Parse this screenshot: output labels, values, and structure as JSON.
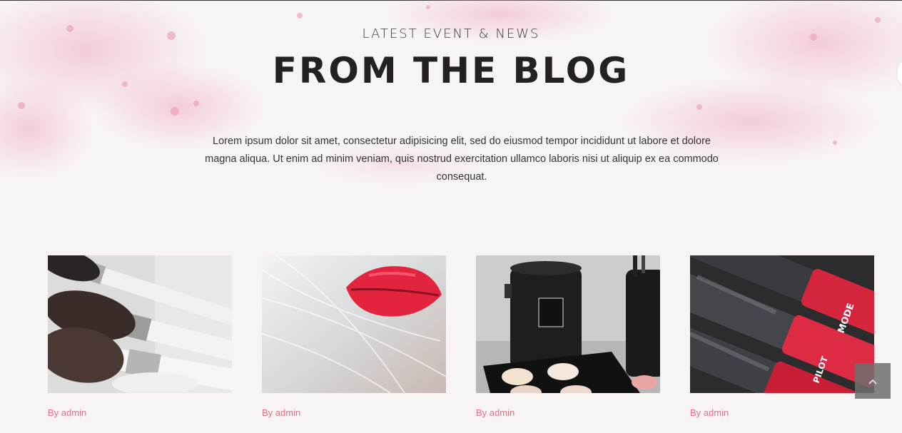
{
  "section": {
    "subtitle": "LATEST EVENT & NEWS",
    "title": "FROM THE BLOG",
    "description": "Lorem ipsum dolor sit amet, consectetur adipisicing elit, sed do eiusmod tempor incididunt ut labore et dolore magna aliqua. Ut enim ad minim veniam, quis nostrud exercitation ullamco laboris nisi ut aliquip ex ea commodo consequat."
  },
  "posts": [
    {
      "byline": "By admin",
      "image": "makeup-brushes-image"
    },
    {
      "byline": "By admin",
      "image": "red-lips-image"
    },
    {
      "byline": "By admin",
      "image": "brush-holder-palette-image"
    },
    {
      "byline": "By admin",
      "image": "nail-polish-image"
    }
  ],
  "scroll_top": {
    "icon": "chevron-up-icon"
  },
  "colors": {
    "accent": "#e0708a",
    "background": "#f8f4f4",
    "title": "#222222"
  }
}
